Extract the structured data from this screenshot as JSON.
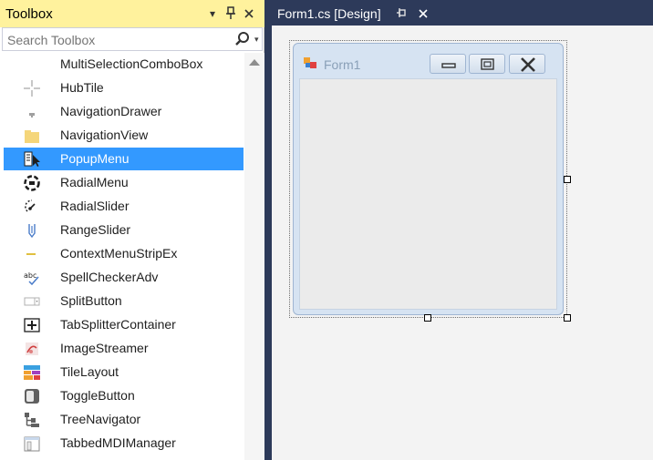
{
  "toolbox": {
    "title": "Toolbox",
    "search_placeholder": "Search Toolbox",
    "items": [
      {
        "label": "MultiSelectionComboBox",
        "icon": "multiselection-combobox-icon",
        "selected": false
      },
      {
        "label": "HubTile",
        "icon": "hubtile-icon",
        "selected": false
      },
      {
        "label": "NavigationDrawer",
        "icon": "navigation-drawer-icon",
        "selected": false
      },
      {
        "label": "NavigationView",
        "icon": "navigation-view-icon",
        "selected": false
      },
      {
        "label": "PopupMenu",
        "icon": "popup-menu-icon",
        "selected": true
      },
      {
        "label": "RadialMenu",
        "icon": "radial-menu-icon",
        "selected": false
      },
      {
        "label": "RadialSlider",
        "icon": "radial-slider-icon",
        "selected": false
      },
      {
        "label": "RangeSlider",
        "icon": "range-slider-icon",
        "selected": false
      },
      {
        "label": "ContextMenuStripEx",
        "icon": "context-menu-strip-icon",
        "selected": false
      },
      {
        "label": "SpellCheckerAdv",
        "icon": "spell-checker-icon",
        "selected": false
      },
      {
        "label": "SplitButton",
        "icon": "split-button-icon",
        "selected": false
      },
      {
        "label": "TabSplitterContainer",
        "icon": "tab-splitter-container-icon",
        "selected": false
      },
      {
        "label": "ImageStreamer",
        "icon": "image-streamer-icon",
        "selected": false
      },
      {
        "label": "TileLayout",
        "icon": "tile-layout-icon",
        "selected": false
      },
      {
        "label": "ToggleButton",
        "icon": "toggle-button-icon",
        "selected": false
      },
      {
        "label": "TreeNavigator",
        "icon": "tree-navigator-icon",
        "selected": false
      },
      {
        "label": "TabbedMDIManager",
        "icon": "tabbed-mdi-manager-icon",
        "selected": false
      }
    ]
  },
  "document": {
    "tab_label": "Form1.cs [Design]",
    "form_title": "Form1"
  },
  "colors": {
    "toolbox_header": "#fff29d",
    "selection": "#3399ff",
    "chrome": "#2d3a5a",
    "designer_bg": "#f3f3f3"
  }
}
